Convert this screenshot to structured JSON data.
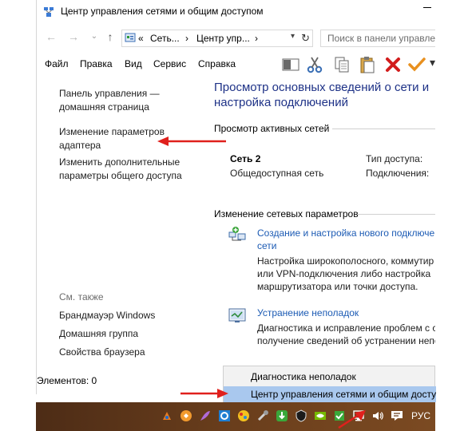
{
  "window": {
    "title": "Центр управления сетями и общим доступом"
  },
  "nav": {
    "back_icon": "back-arrow-icon",
    "forward_icon": "forward-arrow-icon",
    "up_icon": "up-arrow-icon",
    "breadcrumb": [
      "«",
      "Сеть...",
      "›",
      "Центр упр...",
      "›"
    ],
    "search_placeholder": "Поиск в панели управле"
  },
  "menubar": {
    "items": [
      "Файл",
      "Правка",
      "Вид",
      "Сервис",
      "Справка"
    ]
  },
  "left_pane": {
    "home_link": [
      "Панель управления —",
      "домашняя страница"
    ],
    "adapter_link": [
      "Изменение параметров",
      "адаптера"
    ],
    "sharing_link": [
      "Изменить дополнительные",
      "параметры общего доступа"
    ],
    "see_also": "См. также",
    "see_also_links": [
      "Брандмауэр Windows",
      "Домашняя группа",
      "Свойства браузера"
    ]
  },
  "main": {
    "heading": [
      "Просмотр основных сведений о сети и",
      "настройка подключений"
    ],
    "active_networks_title": "Просмотр активных сетей",
    "network": {
      "name": "Сеть  2",
      "type": "Общедоступная сеть",
      "access_label": "Тип доступа:",
      "connections_label": "Подключения:"
    },
    "change_title": "Изменение сетевых параметров",
    "tasks": [
      {
        "link": [
          "Создание и настройка нового подключе",
          "сети"
        ],
        "desc": [
          "Настройка широкополосного, коммутир",
          "или VPN-подключения либо настройка",
          "маршрутизатора или точки доступа."
        ]
      },
      {
        "link": [
          "Устранение неполадок"
        ],
        "desc": [
          "Диагностика и исправление проблем с с",
          "получение сведений об устранении непо"
        ]
      }
    ]
  },
  "status": {
    "items_count": "Элементов: 0"
  },
  "popup": {
    "items": [
      "Диагностика неполадок",
      "Центр управления сетями и общим досту"
    ],
    "highlighted": 1
  },
  "taskbar": {
    "language": "РУС"
  },
  "colors": {
    "heading": "#1e3287",
    "link": "#1c5bb4",
    "arrow": "#e0201c",
    "highlight": "#a9c8ee",
    "taskbar": "#6a3e1c"
  }
}
